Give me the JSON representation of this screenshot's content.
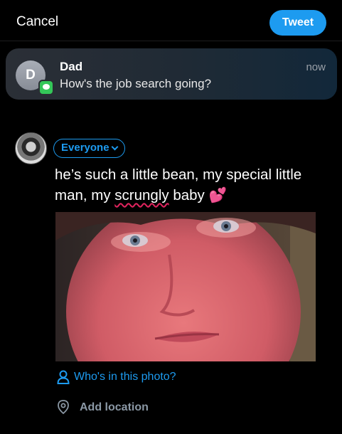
{
  "header": {
    "cancel_label": "Cancel",
    "tweet_label": "Tweet"
  },
  "notification": {
    "avatar_initial": "D",
    "sender": "Dad",
    "message": "How's the job search going?",
    "time": "now",
    "badge_icon": "messages-app-icon"
  },
  "composer": {
    "audience_label": "Everyone",
    "text_before": "he’s such a little bean, my special little man, my ",
    "misspelled_word": "scrungly",
    "text_after": " baby 💕",
    "photo_icon": "attached-photo"
  },
  "actions": {
    "tag_people_label": "Who's in this photo?",
    "tag_people_icon": "person-icon",
    "location_label": "Add location",
    "location_icon": "location-pin-icon"
  },
  "colors": {
    "accent": "#1d9bf0",
    "background": "#000000",
    "secondary_text": "#8b98a5"
  }
}
